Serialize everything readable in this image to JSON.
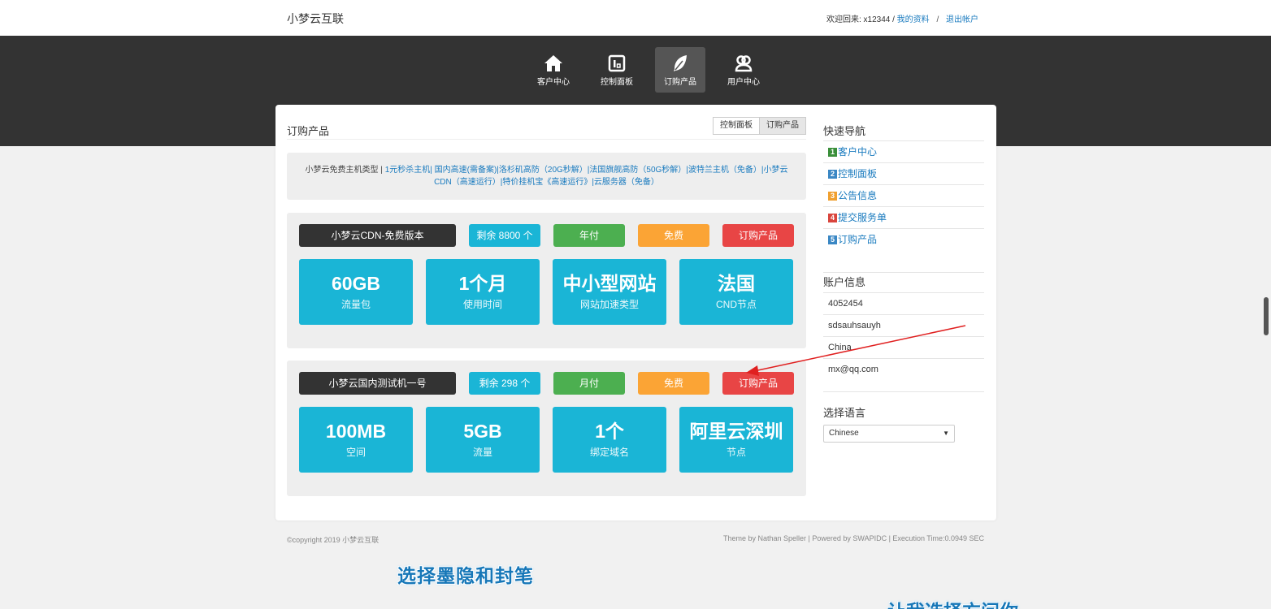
{
  "header": {
    "brand": "小梦云互联",
    "welcome": "欢迎回来: x12344 /",
    "profile_link": "我的资料",
    "separator": "/",
    "logout_link": "退出帐户"
  },
  "nav": [
    {
      "label": "客户中心",
      "icon": "home-icon",
      "active": false
    },
    {
      "label": "控制面板",
      "icon": "dashboard-icon",
      "active": false
    },
    {
      "label": "订购产品",
      "icon": "feather-icon",
      "active": true
    },
    {
      "label": "用户中心",
      "icon": "users-icon",
      "active": false
    }
  ],
  "main": {
    "title": "订购产品",
    "crumbs": [
      "控制面板",
      "订购产品"
    ],
    "types_prefix": "小梦云免费主机类型 |",
    "types_links": "1元秒杀主机| 国内高速(需备案)|洛杉矶高防（20G秒解）|法国旗舰高防（50G秒解）|波特兰主机（免备）|小梦云CDN（高速运行）|特价挂机宝《高速运行》|云服务器（免备）"
  },
  "products": [
    {
      "name": "小梦云CDN-免费版本",
      "stock": "剩余 8800 个",
      "cycle": "年付",
      "price": "免费",
      "order": "订购产品",
      "tiles": [
        {
          "big": "60GB",
          "small": "流量包"
        },
        {
          "big": "1个月",
          "small": "使用时间"
        },
        {
          "big": "中小型网站",
          "small": "网站加速类型"
        },
        {
          "big": "法国",
          "small": "CND节点"
        }
      ]
    },
    {
      "name": "小梦云国内测试机一号",
      "stock": "剩余 298 个",
      "cycle": "月付",
      "price": "免费",
      "order": "订购产品",
      "tiles": [
        {
          "big": "100MB",
          "small": "空间"
        },
        {
          "big": "5GB",
          "small": "流量"
        },
        {
          "big": "1个",
          "small": "绑定域名"
        },
        {
          "big": "阿里云深圳",
          "small": "节点"
        }
      ]
    }
  ],
  "sidebar": {
    "quick_nav_title": "快速导航",
    "quick_nav": [
      {
        "num": "1",
        "label": "客户中心",
        "color": "#3a8f3a"
      },
      {
        "num": "2",
        "label": "控制面板",
        "color": "#3a87c4"
      },
      {
        "num": "3",
        "label": "公告信息",
        "color": "#f0a030"
      },
      {
        "num": "4",
        "label": "提交服务单",
        "color": "#d9453d"
      },
      {
        "num": "5",
        "label": "订购产品",
        "color": "#3a87c4"
      }
    ],
    "account_title": "账户信息",
    "account": [
      "4052454",
      "sdsauhsauyh",
      "China",
      "mx@qq.com"
    ],
    "lang_title": "选择语言",
    "lang_value": "Chinese"
  },
  "footer": {
    "copyright": "©copyright 2019 小梦云互联",
    "credits": "Theme by Nathan Speller | Powered by SWAPIDC | Execution Time:0.0949 SEC"
  },
  "overlay": {
    "caption1": "选择墨隐和封笔",
    "caption2": "让我选择方问你"
  }
}
